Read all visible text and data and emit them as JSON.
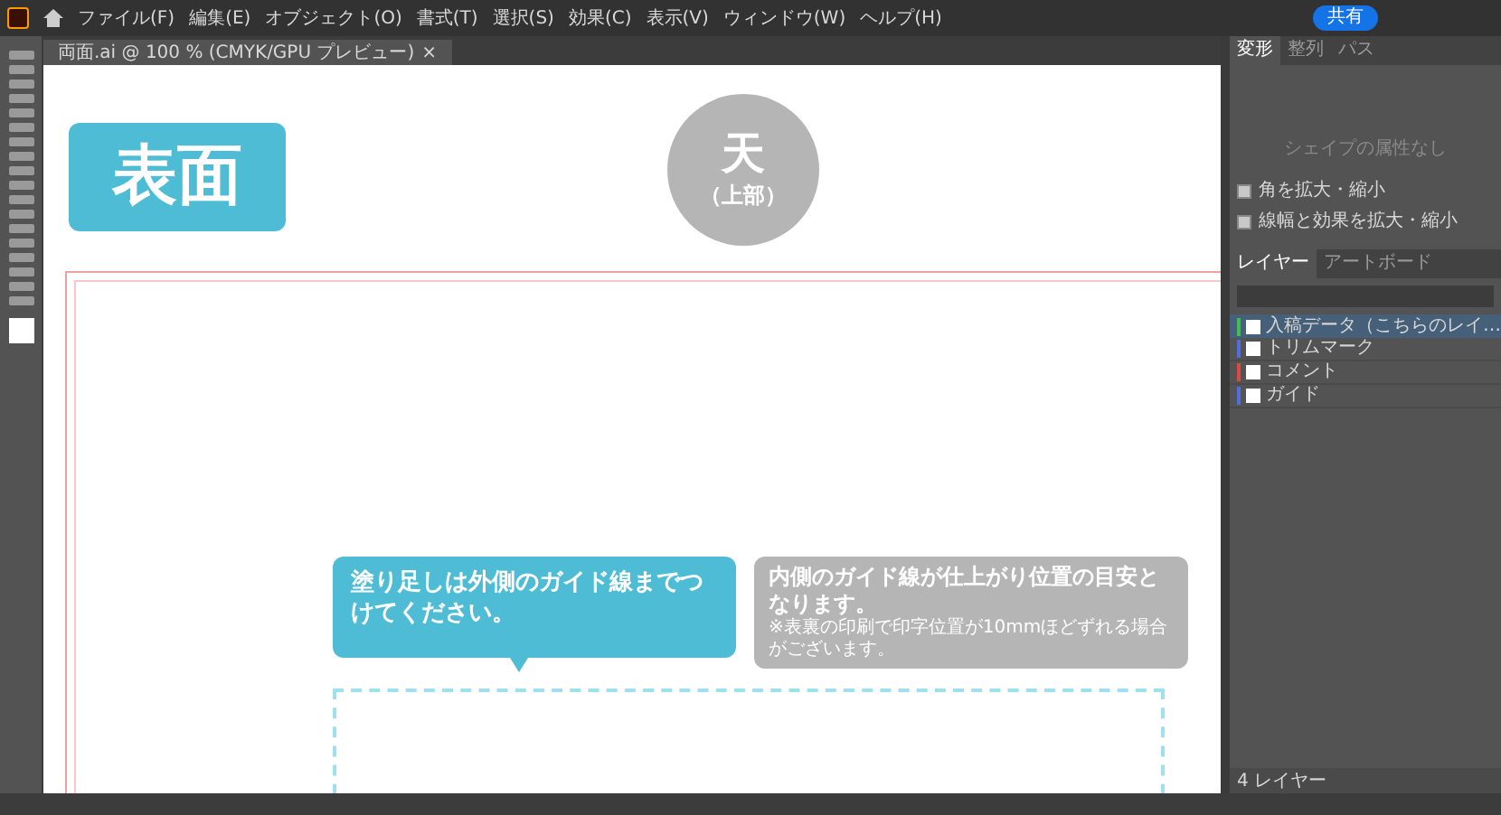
{
  "menu_bar": {
    "items": [
      "ファイル(F)",
      "編集(E)",
      "オブジェクト(O)",
      "書式(T)",
      "選択(S)",
      "効果(C)",
      "表示(V)",
      "ウィンドウ(W)",
      "ヘルプ(H)"
    ],
    "share_button": "共有"
  },
  "document_tab": {
    "title": "両面.ai @ 100 % (CMYK/GPU プレビュー)",
    "close": "×"
  },
  "artboard": {
    "side_badge": "表面",
    "top_marker": {
      "title": "天",
      "subtitle": "（上部）"
    },
    "callouts": [
      {
        "kind": "pointer",
        "text": "塗り足しは外側のガイド線までつけてください。"
      },
      {
        "kind": "note",
        "text": "内側のガイド線が仕上がり位置の目安となります。",
        "note": "※表裏の印刷で印字位置が10mmほどずれる場合がございます。"
      }
    ]
  },
  "properties_panel": {
    "tabs": [
      {
        "label": "変形",
        "selected": true
      },
      {
        "label": "整列",
        "selected": false
      },
      {
        "label": "パス",
        "selected": false
      }
    ],
    "empty_message": "シェイプの属性なし",
    "options": [
      {
        "label": "角を拡大・縮小",
        "checked": true
      },
      {
        "label": "線幅と効果を拡大・縮小",
        "checked": true
      }
    ]
  },
  "layers_panel": {
    "tabs": [
      {
        "label": "レイヤー",
        "selected": true
      },
      {
        "label": "アートボード",
        "selected": false
      }
    ],
    "layers": [
      {
        "name": "入稿データ（こちらのレイ…",
        "color": "#3fbf4f",
        "selected": true
      },
      {
        "name": "トリムマーク",
        "color": "#4f6fe0",
        "selected": false
      },
      {
        "name": "コメント",
        "color": "#e04848",
        "selected": false
      },
      {
        "name": "ガイド",
        "color": "#4f6fe0",
        "selected": false
      }
    ],
    "footer": "4 レイヤー"
  }
}
